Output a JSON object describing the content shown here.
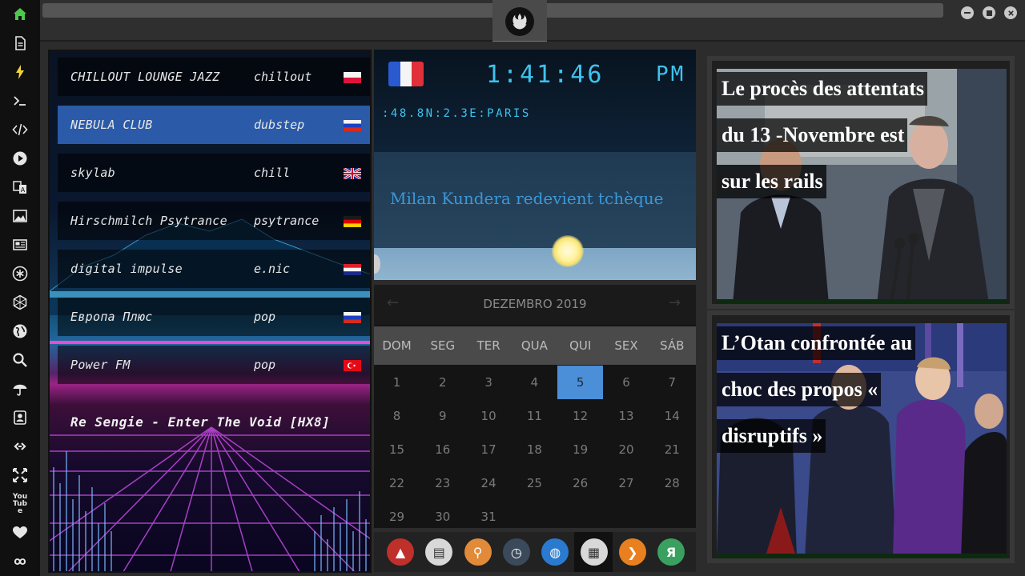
{
  "sidebar": {
    "icons": [
      "home-icon",
      "document-icon",
      "lightning-icon",
      "terminal-icon",
      "code-icon",
      "play-icon",
      "translate-icon",
      "image-icon",
      "newspaper-icon",
      "asterisk-icon",
      "hexagon-icon",
      "globe-icon",
      "search-icon",
      "umbrella-icon",
      "contacts-icon",
      "link-icon",
      "expand-icon",
      "youtube-icon",
      "heart-icon",
      "infinity-icon"
    ],
    "youtube_label": "You Tube"
  },
  "radio": {
    "stations": [
      {
        "name": "CHILLOUT LOUNGE JAZZ",
        "genre": "chillout",
        "flag": "poland"
      },
      {
        "name": "NEBULA CLUB",
        "genre": "dubstep",
        "flag": "russia"
      },
      {
        "name": "skylab",
        "genre": "chill",
        "flag": "uk"
      },
      {
        "name": "Hirschmilch Psytrance",
        "genre": "psytrance",
        "flag": "germany"
      },
      {
        "name": "digital impulse",
        "genre": "e.nic",
        "flag": "croatia"
      },
      {
        "name": "Европа Плюс",
        "genre": "pop",
        "flag": "russia"
      },
      {
        "name": "Power FM",
        "genre": "pop",
        "flag": "turkey"
      }
    ],
    "active_index": 1,
    "now_playing": "Re Sengie - Enter The Void [HX8]"
  },
  "clock": {
    "time": "1:41:46",
    "ampm": "PM",
    "geo": ":48.8N:2.3E:PARIS",
    "headline": "Milan Kundera redevient tchèque"
  },
  "calendar": {
    "title": "DEZEMBRO 2019",
    "weekdays": [
      "DOM",
      "SEG",
      "TER",
      "QUA",
      "QUI",
      "SEX",
      "SÁB"
    ],
    "days": [
      "1",
      "2",
      "3",
      "4",
      "5",
      "6",
      "7",
      "8",
      "9",
      "10",
      "11",
      "12",
      "13",
      "14",
      "15",
      "16",
      "17",
      "18",
      "19",
      "20",
      "21",
      "22",
      "23",
      "24",
      "25",
      "26",
      "27",
      "28",
      "29",
      "30",
      "31"
    ],
    "first_weekday": 0,
    "today": 5
  },
  "dock": {
    "items": [
      {
        "icon": "arch-icon",
        "glyph": "▲",
        "color": "#c0302a"
      },
      {
        "icon": "news-reader-icon",
        "glyph": "▤",
        "color": "#d8d8d8"
      },
      {
        "icon": "search-app-icon",
        "glyph": "⚲",
        "color": "#e08a3a"
      },
      {
        "icon": "clock-app-icon",
        "glyph": "◷",
        "color": "#3b4a5a"
      },
      {
        "icon": "browser-globe-icon",
        "glyph": "◍",
        "color": "#2a7ad0"
      },
      {
        "icon": "calendar-app-icon",
        "glyph": "▦",
        "color": "#d8d8d8"
      },
      {
        "icon": "arrow-app-icon",
        "glyph": "❯",
        "color": "#e88020"
      },
      {
        "icon": "yandex-icon",
        "glyph": "Я",
        "color": "#3aa060"
      }
    ],
    "selected_index": 5
  },
  "news": [
    {
      "lines": [
        "Le procès des attentats",
        "du 13 -Novembre est",
        "sur les rails"
      ]
    },
    {
      "lines": [
        "L’Otan confrontée au",
        "choc des propos «",
        "disruptifs »"
      ]
    }
  ]
}
